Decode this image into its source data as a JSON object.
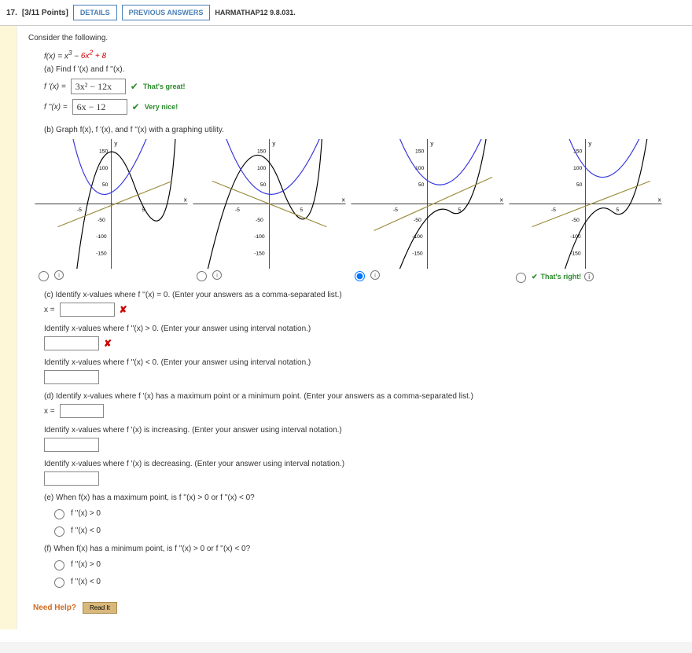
{
  "header": {
    "qnum": "17.",
    "points": "[3/11 Points]",
    "details": "DETAILS",
    "previous": "PREVIOUS ANSWERS",
    "source": "HARMATHAP12 9.8.031."
  },
  "intro": "Consider the following.",
  "fx_left": "f(x) = x",
  "fx_exp1": "3",
  "fx_mid": " − ",
  "fx_red": "6x",
  "fx_exp2": "2",
  "fx_plus": " + ",
  "fx_c": "8",
  "partA": "(a) Find f '(x) and f ''(x).",
  "aRow1Label": "f '(x)  =",
  "aRow1Value": "3x² − 12x",
  "aRow1Fb": "That's great!",
  "aRow2Label": "f ''(x)  =",
  "aRow2Value": "6x − 12",
  "aRow2Fb": "Very nice!",
  "partB": "(b) Graph f(x), f '(x), and f ''(x) with a graphing utility.",
  "graph_feedback": "That's right!",
  "partC": "(c) Identify x-values where f ''(x) = 0. (Enter your answers as a comma-separated list.)",
  "xEquals": "x =",
  "c2": "Identify x-values where f ''(x) > 0. (Enter your answer using interval notation.)",
  "c3": "Identify x-values where f ''(x) < 0. (Enter your answer using interval notation.)",
  "partD": "(d) Identify x-values where f '(x) has a maximum point or a minimum point. (Enter your answers as a comma-separated list.)",
  "d2": "Identify x-values where f '(x) is increasing. (Enter your answer using interval notation.)",
  "d3": "Identify x-values where f '(x) is decreasing. (Enter your answer using interval notation.)",
  "partE": "(e) When f(x) has a maximum point, is f ''(x) > 0 or f ''(x) < 0?",
  "eOpt1": "f ''(x) > 0",
  "eOpt2": "f ''(x) < 0",
  "partF": "(f) When f(x) has a minimum point, is f ''(x) > 0 or f ''(x) < 0?",
  "fOpt1": "f ''(x) > 0",
  "fOpt2": "f ''(x) < 0",
  "needHelp": "Need Help?",
  "readIt": "Read It",
  "chart_data": [
    {
      "type": "line",
      "id": "option1",
      "xlim": [
        -7,
        7
      ],
      "ylim": [
        -170,
        170
      ],
      "xticks": [
        -5,
        5
      ],
      "yticks": [
        -150,
        -100,
        -50,
        50,
        100,
        150
      ],
      "xlabel": "x",
      "ylabel": "y",
      "series": [
        {
          "name": "cubic (black)",
          "notes": "opens from -∞→+∞, local max ~x≈0, local min ~x≈4"
        },
        {
          "name": "parabola f' (blue)",
          "notes": "upward parabola vertex ~(2,-12), roots 0 & 4"
        },
        {
          "name": "line f'' (olive)",
          "notes": "line slope≈6, crosses y-axis ~-12"
        }
      ],
      "note": "parabola vertex appears LEFT of y-axis (incorrect variant)"
    },
    {
      "type": "line",
      "id": "option2",
      "xlim": [
        -7,
        7
      ],
      "ylim": [
        -170,
        170
      ],
      "xticks": [
        -5,
        5
      ],
      "yticks": [
        -150,
        -100,
        -50,
        50,
        100,
        150
      ],
      "xlabel": "x",
      "ylabel": "y",
      "series": [
        {
          "name": "cubic (black)"
        },
        {
          "name": "parabola (blue)"
        },
        {
          "name": "line (olive)"
        }
      ],
      "note": "reflected variant"
    },
    {
      "type": "line",
      "id": "option3",
      "selected": true,
      "xlim": [
        -7,
        7
      ],
      "ylim": [
        -170,
        170
      ],
      "xticks": [
        -5,
        5
      ],
      "yticks": [
        -150,
        -100,
        -50,
        50,
        100,
        150
      ],
      "xlabel": "x",
      "ylabel": "y",
      "series": [
        {
          "name": "f(x)=x^3-6x^2+8 (black)"
        },
        {
          "name": "f'(x)=3x^2-12x (blue)"
        },
        {
          "name": "f''(x)=6x-12 (olive)"
        }
      ]
    },
    {
      "type": "line",
      "id": "option4",
      "correct": true,
      "xlim": [
        -7,
        7
      ],
      "ylim": [
        -170,
        170
      ],
      "xticks": [
        -5,
        5
      ],
      "yticks": [
        -150,
        -100,
        -50,
        50,
        100,
        150
      ],
      "xlabel": "x",
      "ylabel": "y",
      "series": [
        {
          "name": "cubic (black)"
        },
        {
          "name": "parabola (blue)"
        },
        {
          "name": "line (olive)"
        }
      ],
      "note": "curves centered right of y-axis, tighter y-scale look"
    }
  ]
}
